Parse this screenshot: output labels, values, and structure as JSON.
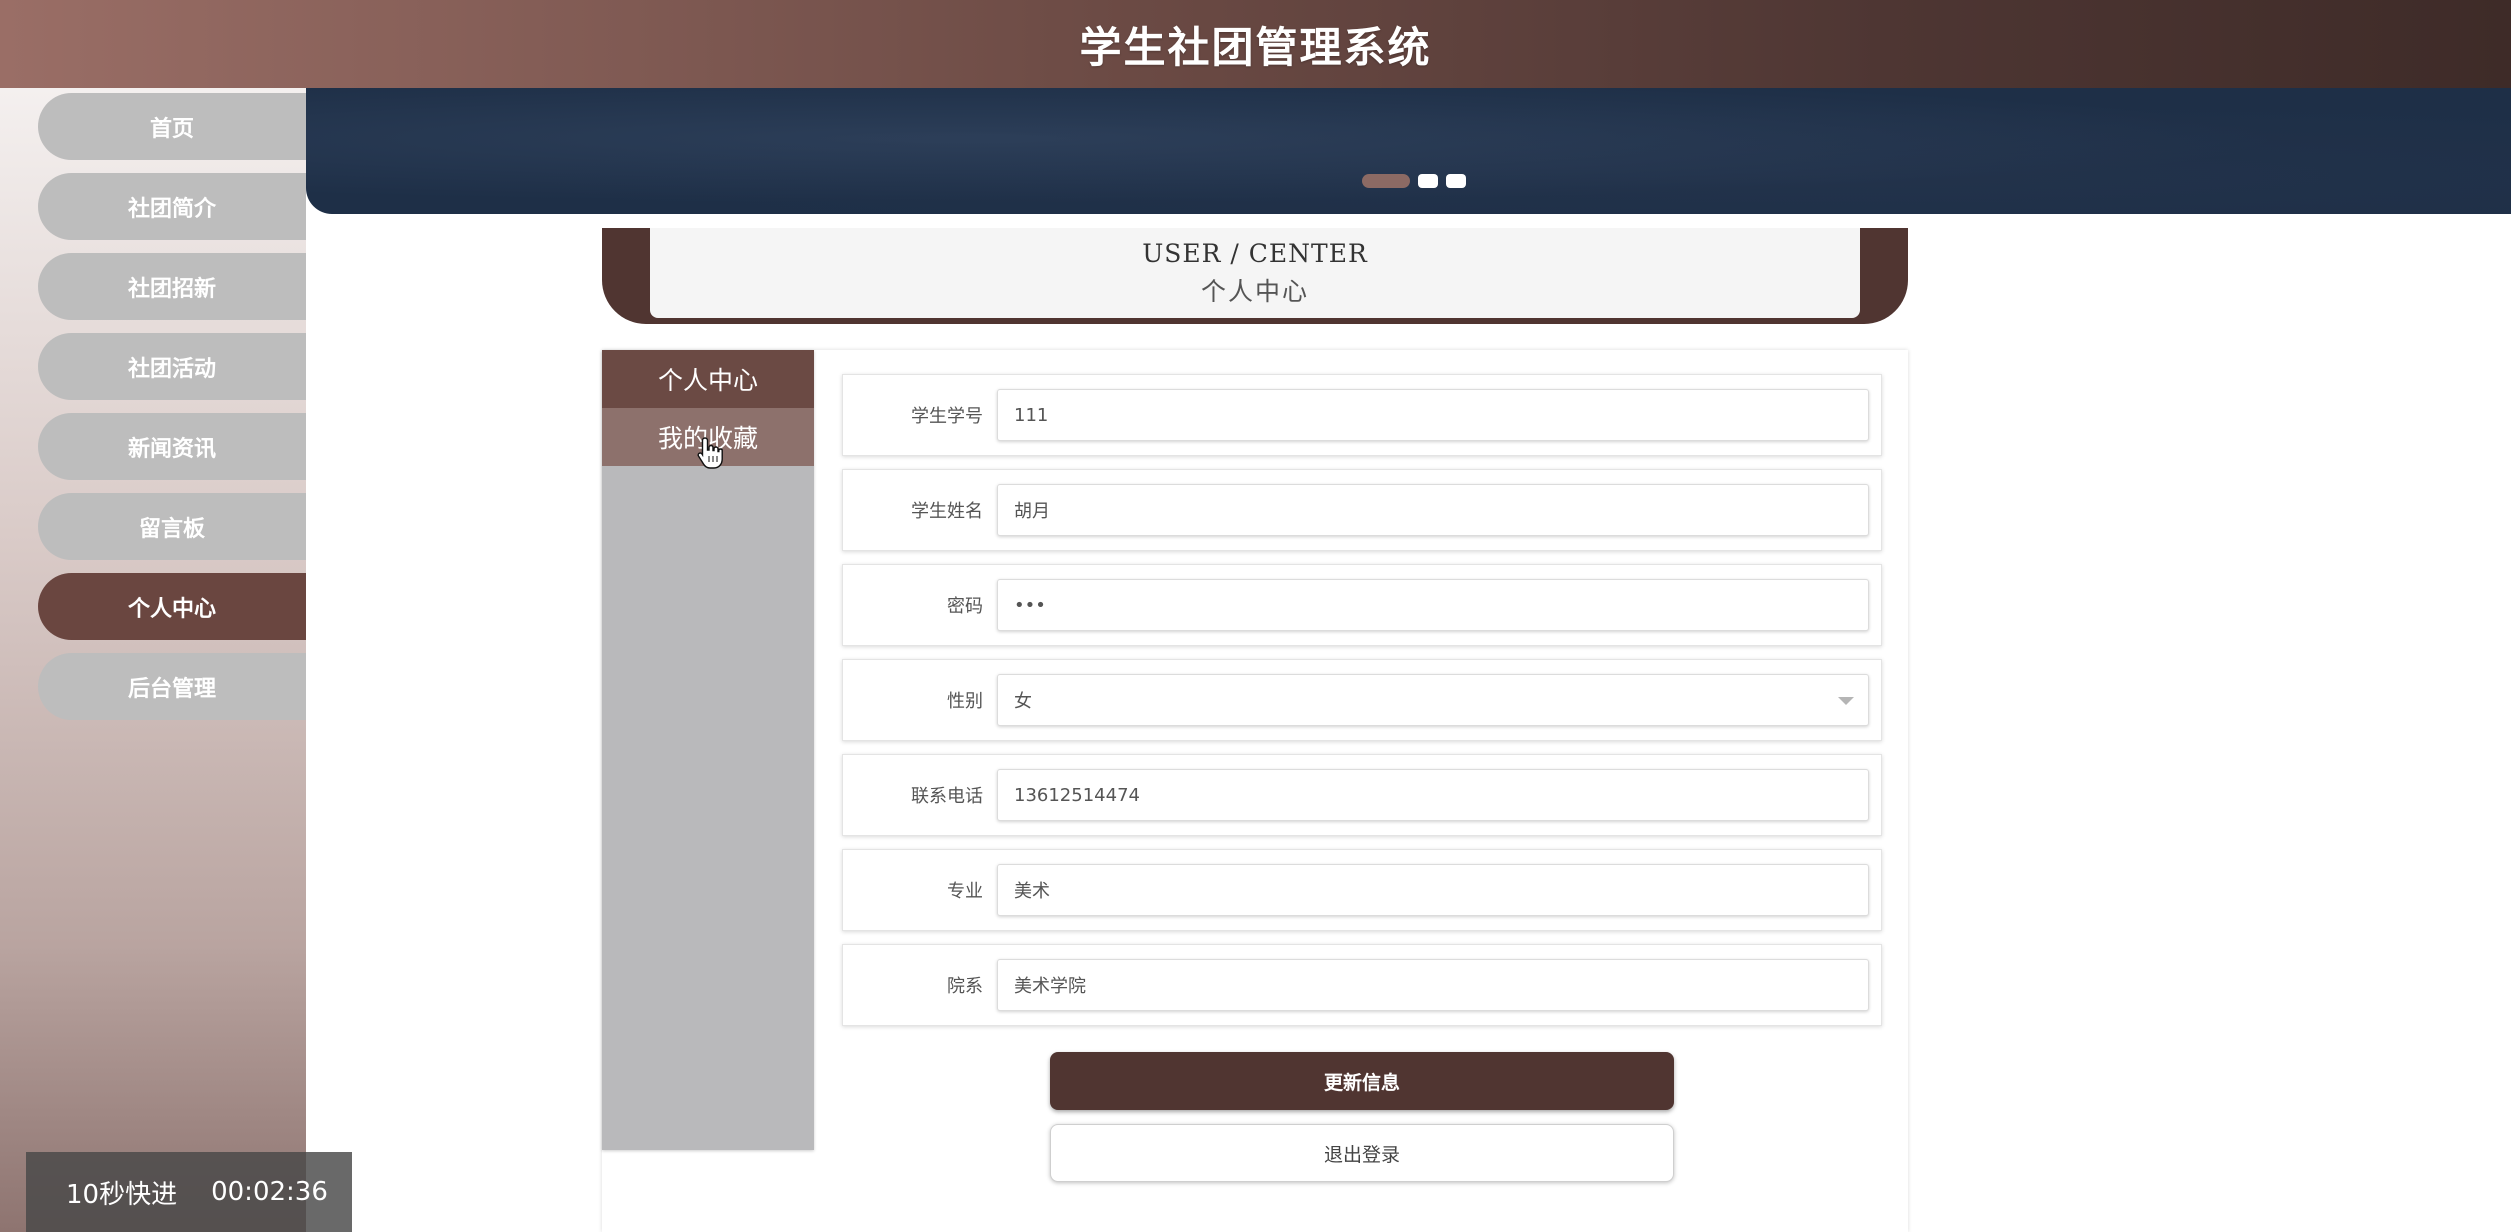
{
  "header": {
    "title": "学生社团管理系统"
  },
  "sidebar": {
    "items": [
      {
        "label": "首页",
        "active": false
      },
      {
        "label": "社团简介",
        "active": false
      },
      {
        "label": "社团招新",
        "active": false
      },
      {
        "label": "社团活动",
        "active": false
      },
      {
        "label": "新闻资讯",
        "active": false
      },
      {
        "label": "留言板",
        "active": false
      },
      {
        "label": "个人中心",
        "active": true
      },
      {
        "label": "后台管理",
        "active": false
      }
    ]
  },
  "user_center": {
    "title_en": "USER / CENTER",
    "title_cn": "个人中心"
  },
  "submenu": {
    "items": [
      {
        "label": "个人中心",
        "state": "active"
      },
      {
        "label": "我的收藏",
        "state": "hover"
      }
    ]
  },
  "form": {
    "fields": [
      {
        "label": "学生学号",
        "value": "111"
      },
      {
        "label": "学生姓名",
        "value": "胡月"
      },
      {
        "label": "密码",
        "value": "•••"
      },
      {
        "label": "性别",
        "value": "女"
      },
      {
        "label": "联系电话",
        "value": "13612514474"
      },
      {
        "label": "专业",
        "value": "美术"
      },
      {
        "label": "院系",
        "value": "美术学院"
      }
    ],
    "update_label": "更新信息",
    "logout_label": "退出登录"
  },
  "video_overlay": {
    "speed_label": "10秒快进",
    "time": "00:02:36"
  },
  "colors": {
    "brand_dark": "#503531",
    "nav_active": "#6a4640",
    "nav_inactive": "#bdbdbd",
    "banner": "#1e2f47"
  }
}
